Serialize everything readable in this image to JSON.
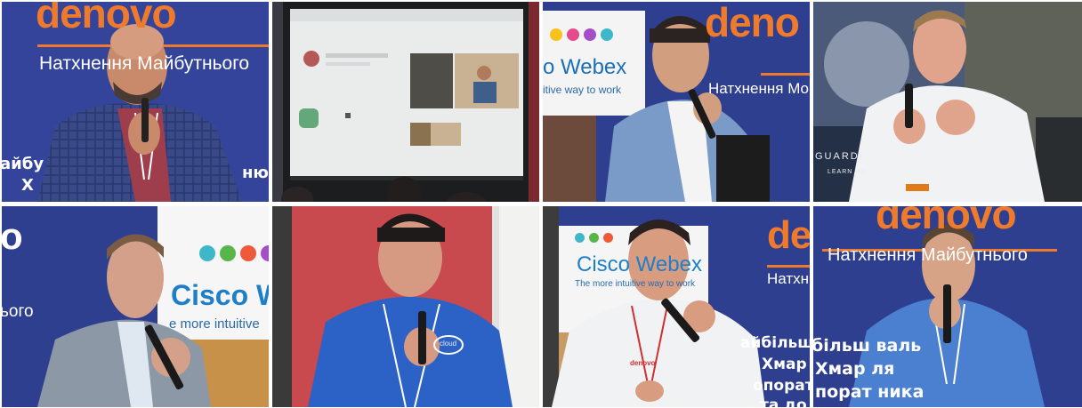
{
  "collage": {
    "tiles": [
      {
        "brand": "denovo",
        "tagline": "Натхнення Майбутнього",
        "side_text": [
          "айбу",
          "Х"
        ],
        "side_text_right": "ню"
      },
      {
        "screen": true
      },
      {
        "brand": "deno",
        "webex_title": "o Webex",
        "webex_sub": "itive way to work",
        "tagline": "Натхнення Мо"
      },
      {
        "poster_title": "GUARDI",
        "poster_sub": "LEARN MO"
      },
      {
        "brand_partial": "o",
        "tagline": "ього",
        "cisco_title": "Cisco W",
        "cisco_sub": "e more intuitive"
      },
      {
        "tshirt_logo": "cloud"
      },
      {
        "brand": "de",
        "tagline": "Натхн",
        "cisco_title": "Cisco Webex",
        "cisco_sub": "The more intuitive way to work",
        "side_lines": [
          "айбільш",
          "Хмар",
          "опорат",
          "та до"
        ],
        "shirt_logo": "denovo"
      },
      {
        "brand": "denovo",
        "tagline": "Натхнення Майбутнього",
        "side_lines": [
          "більш    валь",
          "Хмар         ля",
          "порат      ника"
        ]
      }
    ]
  },
  "colors": {
    "banner_blue": "#2f3f8f",
    "brand_orange": "#f07a2b",
    "cisco_blue": "#1e7fc8",
    "screen_dark": "#1b1d1f"
  }
}
